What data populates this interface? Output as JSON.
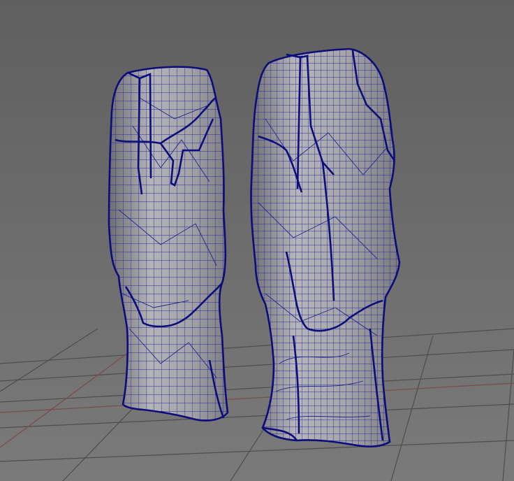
{
  "viewport": {
    "background_top": "#5f5f5f",
    "background_bottom": "#787878",
    "grid_color": "#4e4e4e",
    "grid_axis_color": "#7a4a4a"
  },
  "models": [
    {
      "name": "short-leg-mesh",
      "surface_color": "#9a9a9e",
      "wire_color": "#1f1f8f",
      "edge_color": "#0d0d7a"
    },
    {
      "name": "tall-leg-mesh",
      "surface_color": "#9a9a9e",
      "wire_color": "#1f1f8f",
      "edge_color": "#0d0d7a"
    }
  ]
}
